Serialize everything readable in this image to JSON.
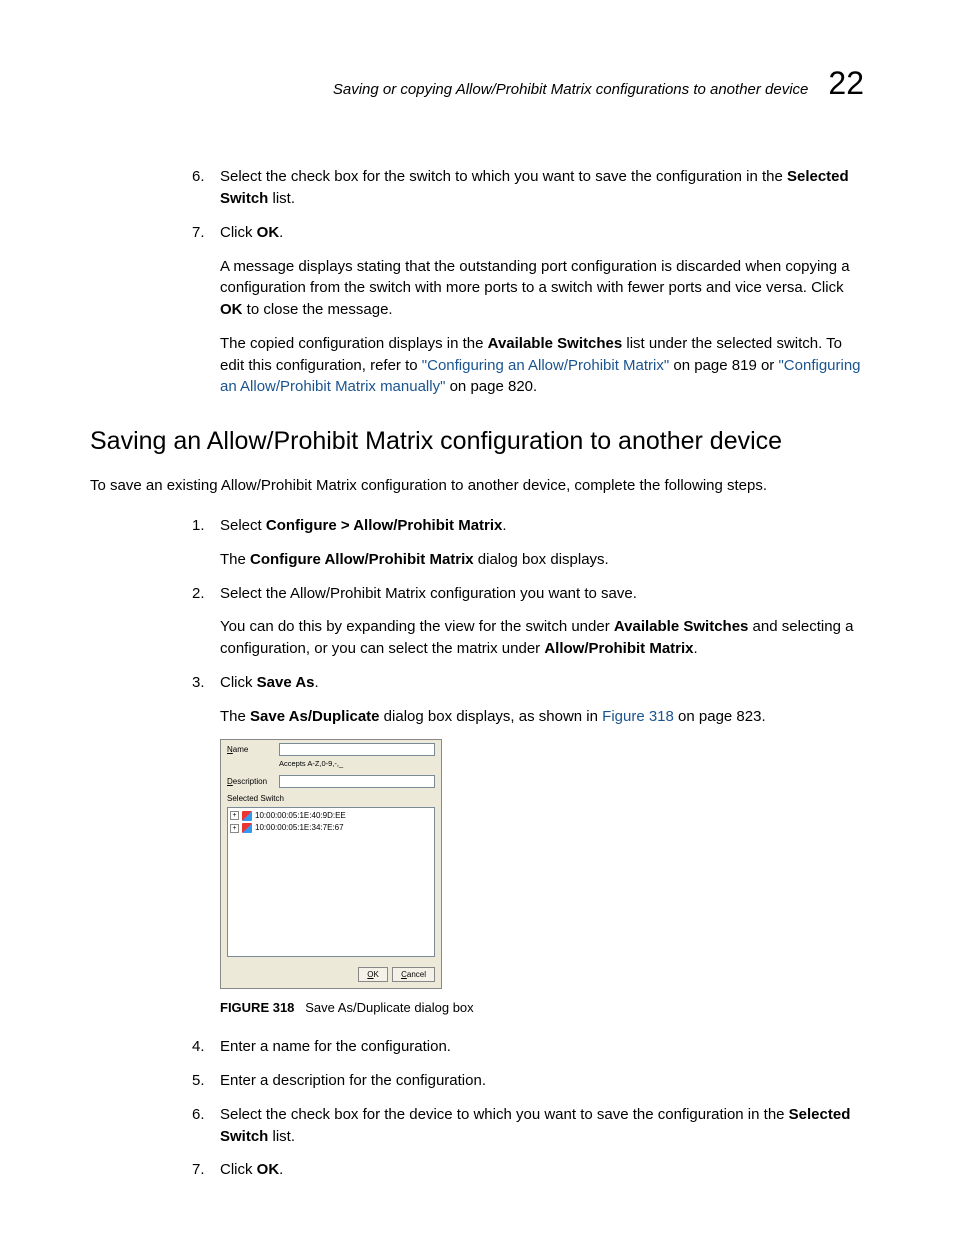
{
  "header": {
    "title": "Saving or copying Allow/Prohibit Matrix configurations to another device",
    "chapter": "22"
  },
  "topSteps": {
    "step6": {
      "num": "6.",
      "before": "Select the check box for the switch to which you want to save the configuration in the ",
      "bold1": "Selected Switch",
      "after": " list."
    },
    "step7": {
      "num": "7.",
      "click": "Click ",
      "ok": "OK",
      "period": ".",
      "p2a": "A message displays stating that the outstanding port configuration is discarded when copying a configuration from the switch with more ports to a switch with fewer ports and vice versa. Click ",
      "p2b": "OK",
      "p2c": " to close the message.",
      "p3a": "The copied configuration displays in the ",
      "p3b": "Available Switches",
      "p3c": " list under the selected switch. To edit this configuration, refer to ",
      "link1": "\"Configuring an Allow/Prohibit Matrix\"",
      "p3d": " on page 819 or ",
      "link2": "\"Configuring an Allow/Prohibit Matrix manually\"",
      "p3e": " on page 820."
    }
  },
  "section": {
    "heading": "Saving an Allow/Prohibit Matrix configuration to another device",
    "intro": "To save an existing Allow/Prohibit Matrix configuration to another device, complete the following steps."
  },
  "steps": {
    "s1": {
      "num": "1.",
      "a": "Select ",
      "b": "Configure > Allow/Prohibit Matrix",
      "c": ".",
      "p2a": "The ",
      "p2b": "Configure Allow/Prohibit Matrix",
      "p2c": " dialog box displays."
    },
    "s2": {
      "num": "2.",
      "a": "Select the Allow/Prohibit Matrix configuration you want to save.",
      "p2a": "You can do this by expanding the view for the switch under ",
      "p2b": "Available Switches",
      "p2c": " and selecting a configuration, or you can select the matrix under ",
      "p2d": "Allow/Prohibit Matrix",
      "p2e": "."
    },
    "s3": {
      "num": "3.",
      "a": "Click ",
      "b": "Save As",
      "c": ".",
      "p2a": "The ",
      "p2b": "Save As/Duplicate",
      "p2c": " dialog box displays, as shown in ",
      "link": "Figure 318",
      "p2d": " on page 823."
    },
    "s4": {
      "num": "4.",
      "a": "Enter a name for the configuration."
    },
    "s5": {
      "num": "5.",
      "a": "Enter a description for the configuration."
    },
    "s6": {
      "num": "6.",
      "a": "Select the check box for the device to which you want to save the configuration in the ",
      "b": "Selected Switch",
      "c": " list."
    },
    "s7": {
      "num": "7.",
      "a": "Click ",
      "b": "OK",
      "c": "."
    }
  },
  "dialog": {
    "nameLabel": "Name",
    "hint": "Accepts A-Z,0-9,-,_",
    "descLabel": "Description",
    "selectedSwitch": "Selected Switch",
    "item1": "10:00:00:05:1E:40:9D:EE",
    "item2": "10:00:00:05:1E:34:7E:67",
    "ok": "OK",
    "cancel": "Cancel"
  },
  "figure": {
    "label": "FIGURE 318",
    "caption": "Save As/Duplicate dialog box"
  }
}
